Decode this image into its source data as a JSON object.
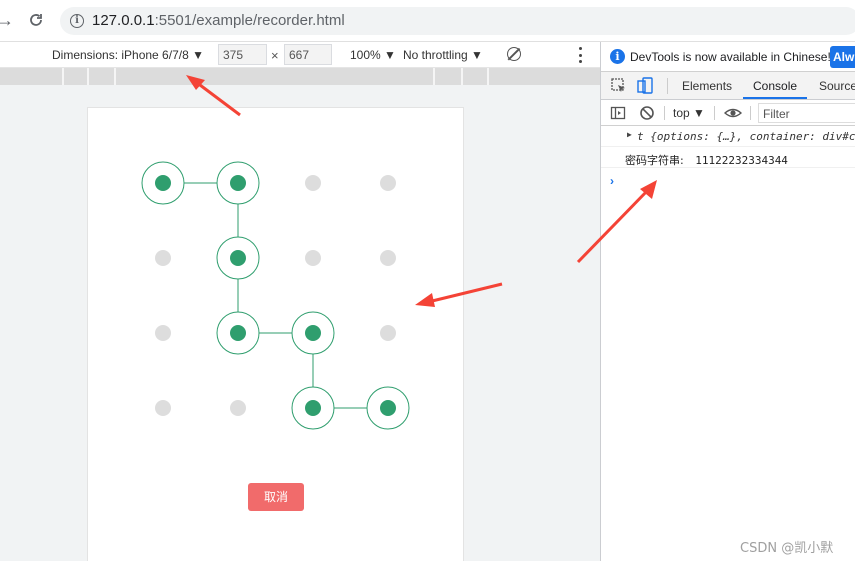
{
  "browser": {
    "url_host": "127.0.0.1",
    "url_path": ":5501/example/recorder.html"
  },
  "device_toolbar": {
    "dimensions_label": "Dimensions: iPhone 6/7/8 ▼",
    "width": "375",
    "height": "667",
    "times": "×",
    "zoom": "100% ▼",
    "throttling": "No throttling ▼"
  },
  "page": {
    "grid_rows": 4,
    "grid_cols": 4,
    "selected_path": [
      [
        0,
        0
      ],
      [
        0,
        1
      ],
      [
        1,
        1
      ],
      [
        2,
        1
      ],
      [
        2,
        2
      ],
      [
        3,
        2
      ],
      [
        3,
        3
      ]
    ],
    "active_color": "#2f9e6e",
    "inactive_color": "#dddddd",
    "cancel_label": "取消",
    "cancel_color": "#f16b6b"
  },
  "devtools": {
    "banner_text": "DevTools is now available in Chinese!",
    "banner_button": "Alw",
    "tabs": [
      "Elements",
      "Console",
      "Source"
    ],
    "active_tab": "Console",
    "context": "top ▼",
    "filter_placeholder": "Filter",
    "logs": {
      "object_line": "t {options: {…}, container: div#co",
      "password_label": "密码字符串:",
      "password_value": "11122232334344"
    },
    "prompt_symbol": "›"
  },
  "watermark": "CSDN @凯小默",
  "annotation_color": "#f44336"
}
